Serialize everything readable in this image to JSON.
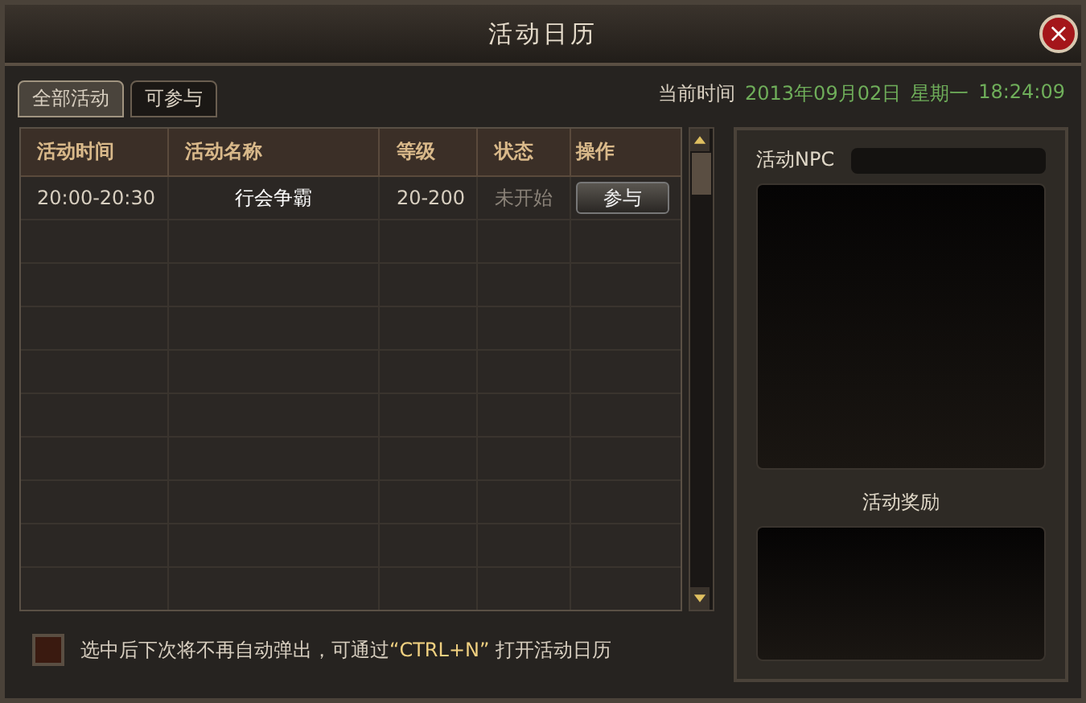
{
  "window": {
    "title": "活动日历",
    "close": "×"
  },
  "tabs": [
    {
      "label": "全部活动",
      "selected": true
    },
    {
      "label": "可参与",
      "selected": false
    }
  ],
  "clock": {
    "label": "当前时间",
    "date": "2013年09月02日",
    "weekday": "星期一",
    "time": "18:24:09"
  },
  "table": {
    "columns": [
      "活动时间",
      "活动名称",
      "等级",
      "状态",
      "操作"
    ],
    "rows": [
      {
        "time": "20:00-20:30",
        "name": "行会争霸",
        "level": "20-200",
        "status": "未开始",
        "started": false,
        "action": "参与"
      }
    ]
  },
  "side": {
    "npc_label": "活动NPC",
    "reward_label": "活动奖励"
  },
  "footer": {
    "checked": false,
    "text": "选中后下次将不再自动弹出，可通过",
    "shortcut": "“CTRL+N”",
    "text_end": "打开活动日历"
  }
}
